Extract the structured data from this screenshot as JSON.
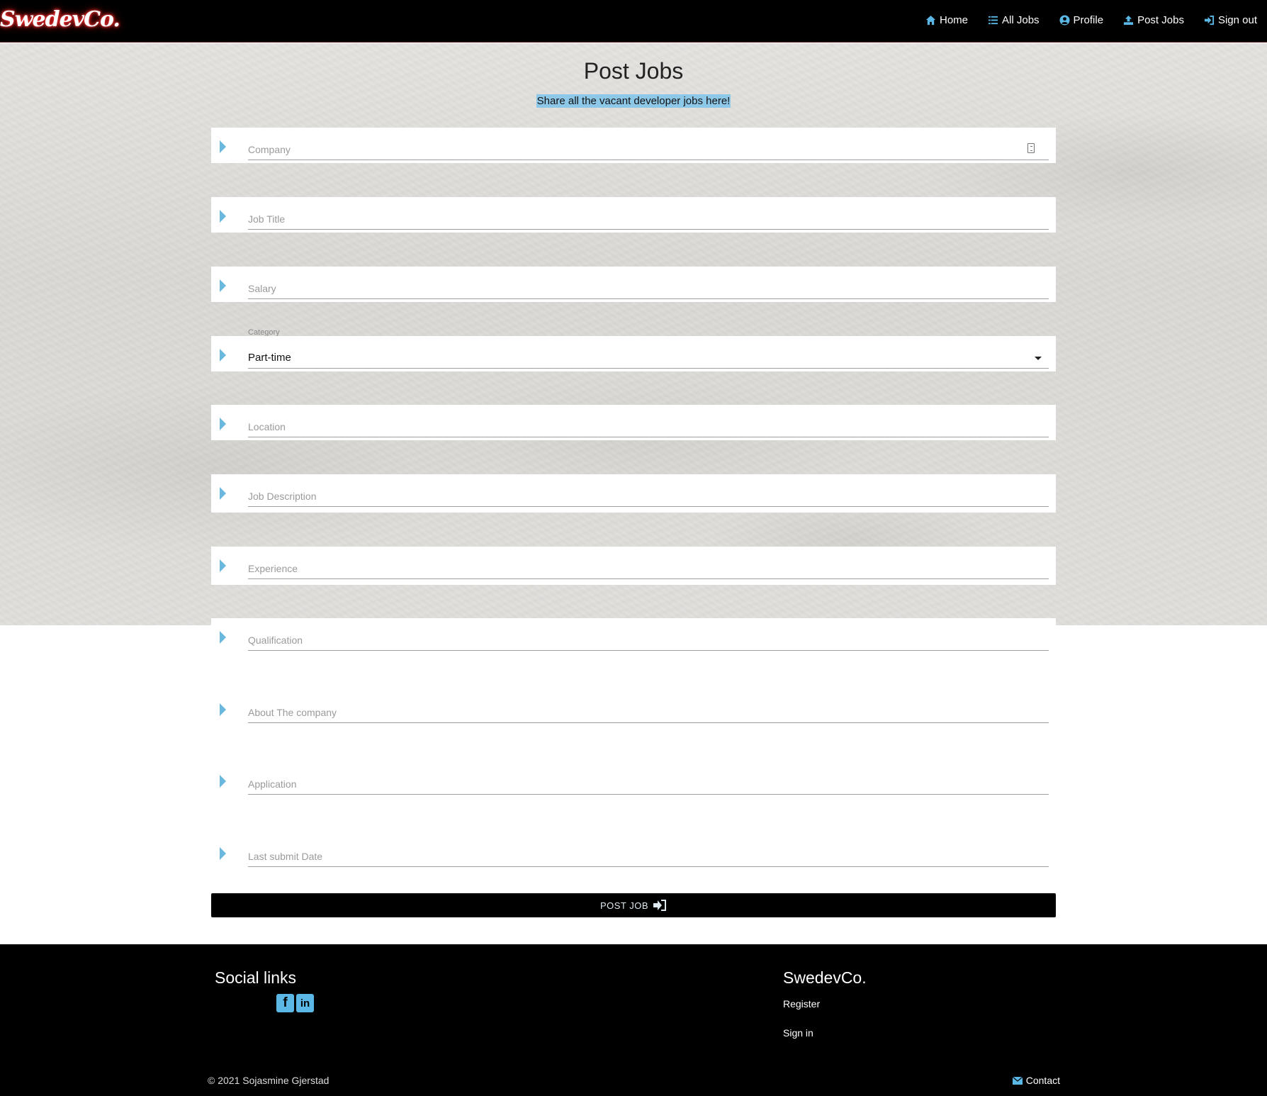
{
  "brand": "SwedevCo.",
  "nav": {
    "items": [
      {
        "label": "Home",
        "icon": "home-icon"
      },
      {
        "label": "All Jobs",
        "icon": "list-icon"
      },
      {
        "label": "Profile",
        "icon": "user-circle-icon"
      },
      {
        "label": "Post Jobs",
        "icon": "upload-icon"
      },
      {
        "label": "Sign out",
        "icon": "sign-out-icon"
      }
    ]
  },
  "page": {
    "title": "Post Jobs",
    "subtitle": "Share all the vacant developer jobs here!"
  },
  "form": {
    "company_placeholder": "Company",
    "job_title_placeholder": "Job Title",
    "salary_placeholder": "Salary",
    "category_label": "Category",
    "category_value": "Part-time",
    "location_placeholder": "Location",
    "job_description_placeholder": "Job Description",
    "experience_placeholder": "Experience",
    "qualification_placeholder": "Qualification",
    "about_company_placeholder": "About The company",
    "application_placeholder": "Application",
    "last_submit_date_placeholder": "Last submit Date",
    "submit_label": "POST JOB"
  },
  "footer": {
    "social_title": "Social links",
    "social_icons": [
      "facebook-icon",
      "linkedin-icon"
    ],
    "brand": "SwedevCo.",
    "register": "Register",
    "sign_in": "Sign in",
    "copyright": "© 2021 Sojasmine Gjerstad",
    "contact": "Contact"
  },
  "colors": {
    "accent": "#5bb8e6",
    "navbar": "#000000",
    "highlight": "#8ec8e8"
  }
}
